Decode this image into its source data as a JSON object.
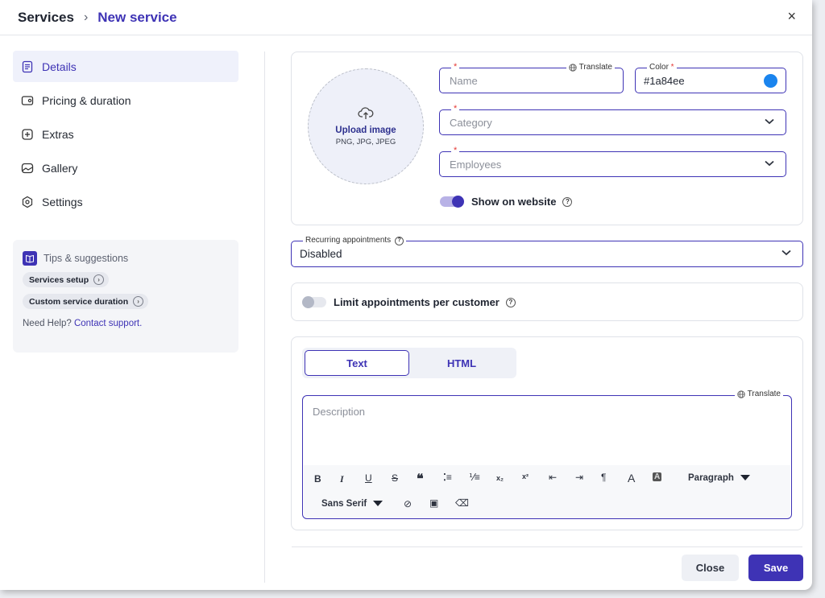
{
  "header": {
    "breadcrumb_root": "Services",
    "breadcrumb_sep": "›",
    "breadcrumb_current": "New service",
    "close": "×"
  },
  "sidebar": {
    "items": [
      {
        "label": "Details",
        "icon": "document-icon",
        "active": true
      },
      {
        "label": "Pricing & duration",
        "icon": "wallet-icon",
        "active": false
      },
      {
        "label": "Extras",
        "icon": "plus-box-icon",
        "active": false
      },
      {
        "label": "Gallery",
        "icon": "image-icon",
        "active": false
      },
      {
        "label": "Settings",
        "icon": "gear-icon",
        "active": false
      }
    ],
    "tips": {
      "title": "Tips & suggestions",
      "chips": [
        "Services setup",
        "Custom service duration"
      ],
      "help_prefix": "Need Help?",
      "help_link": "Contact support."
    }
  },
  "upload": {
    "title": "Upload image",
    "formats": "PNG, JPG, JPEG"
  },
  "form": {
    "name_placeholder": "Name",
    "translate": "Translate",
    "color_label": "Color",
    "color_value": "#1a84ee",
    "category_placeholder": "Category",
    "employees_placeholder": "Employees",
    "show_on_website": "Show on website",
    "recurring_label": "Recurring appointments",
    "recurring_value": "Disabled",
    "limit_label": "Limit appointments per customer"
  },
  "editor": {
    "tab_text": "Text",
    "tab_html": "HTML",
    "translate": "Translate",
    "placeholder": "Description",
    "paragraph": "Paragraph",
    "font": "Sans Serif"
  },
  "footer": {
    "close": "Close",
    "save": "Save"
  },
  "colors": {
    "accent": "#3e33b5",
    "swatch": "#1a84ee"
  }
}
